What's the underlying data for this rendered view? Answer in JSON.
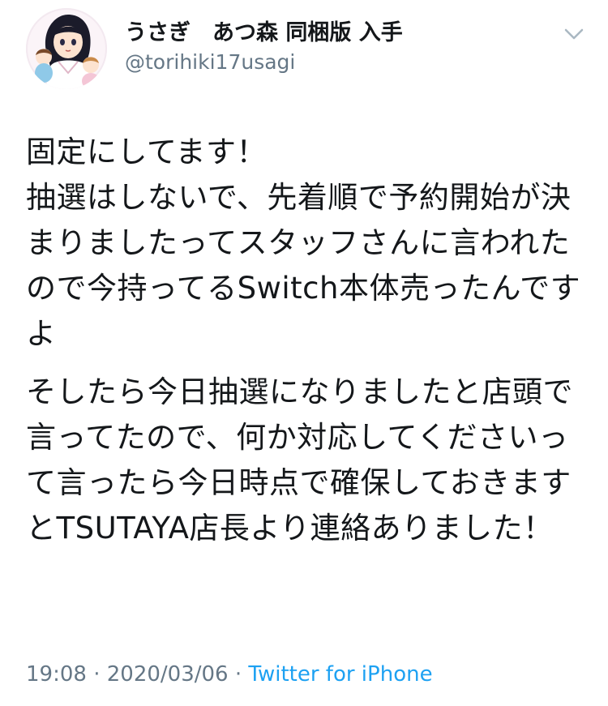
{
  "user": {
    "display_name": "うさぎ　あつ森 同梱版 入手",
    "handle": "@torihiki17usagi"
  },
  "tweet": {
    "paragraphs": [
      "固定にしてます！\n抽選はしないで、先着順で予約開始が決まりましたってスタッフさんに言われたので今持ってるSwitch本体売ったんですよ",
      "そしたら今日抽選になりましたと店頭で言ってたので、何か対応してくださいって言ったら今日時点で確保しておきますとTSUTAYA店長より連絡ありました！"
    ]
  },
  "meta": {
    "time": "19:08",
    "separator1": " · ",
    "date": "2020/03/06",
    "separator2": " · ",
    "source": "Twitter for iPhone"
  },
  "icons": {
    "menu": "chevron-down-icon",
    "avatar": "avatar-image"
  },
  "colors": {
    "text": "#14171a",
    "secondary": "#657786",
    "link": "#1da1f2"
  }
}
